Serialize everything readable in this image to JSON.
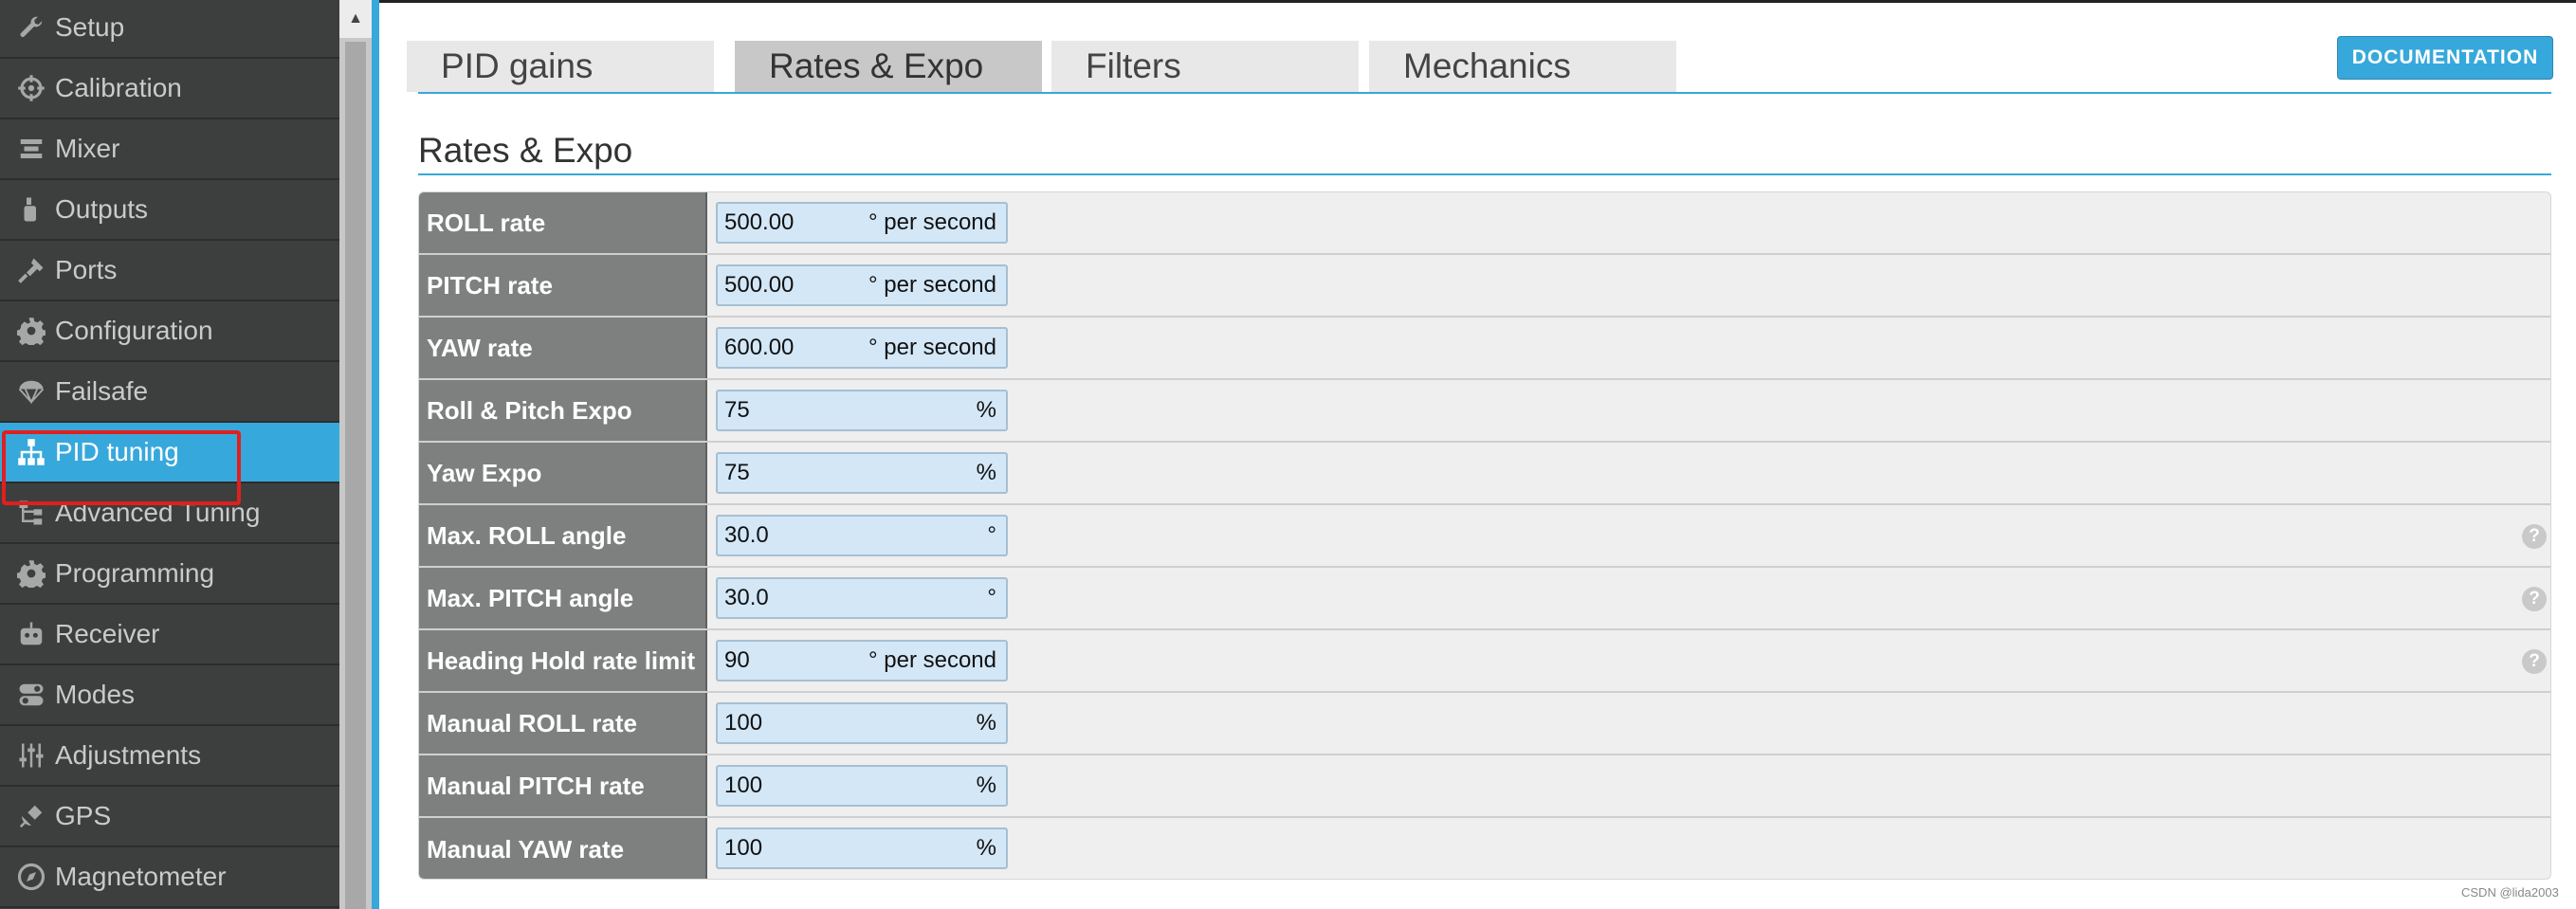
{
  "sidebar": {
    "items": [
      {
        "label": "Setup",
        "icon": "wrench-icon",
        "active": false
      },
      {
        "label": "Calibration",
        "icon": "crosshair-icon",
        "active": false
      },
      {
        "label": "Mixer",
        "icon": "mixer-icon",
        "active": false
      },
      {
        "label": "Outputs",
        "icon": "motor-icon",
        "active": false
      },
      {
        "label": "Ports",
        "icon": "plug-icon",
        "active": false
      },
      {
        "label": "Configuration",
        "icon": "gear-icon",
        "active": false
      },
      {
        "label": "Failsafe",
        "icon": "parachute-icon",
        "active": false
      },
      {
        "label": "PID tuning",
        "icon": "hierarchy-icon",
        "active": true
      },
      {
        "label": "Advanced Tuning",
        "icon": "tree-icon",
        "active": false
      },
      {
        "label": "Programming",
        "icon": "gear-icon",
        "active": false
      },
      {
        "label": "Receiver",
        "icon": "robot-icon",
        "active": false
      },
      {
        "label": "Modes",
        "icon": "toggle-icon",
        "active": false
      },
      {
        "label": "Adjustments",
        "icon": "sliders-icon",
        "active": false
      },
      {
        "label": "GPS",
        "icon": "satellite-icon",
        "active": false
      },
      {
        "label": "Magnetometer",
        "icon": "compass-icon",
        "active": false
      }
    ]
  },
  "tabs": [
    {
      "label": "PID gains",
      "active": false
    },
    {
      "label": "Rates & Expo",
      "active": true
    },
    {
      "label": "Filters",
      "active": false
    },
    {
      "label": "Mechanics",
      "active": false
    }
  ],
  "documentation_button": "DOCUMENTATION",
  "section_title": "Rates & Expo",
  "rows": [
    {
      "label": "ROLL rate",
      "value": "500.00",
      "unit": "° per second",
      "help": false
    },
    {
      "label": "PITCH rate",
      "value": "500.00",
      "unit": "° per second",
      "help": false
    },
    {
      "label": "YAW rate",
      "value": "600.00",
      "unit": "° per second",
      "help": false
    },
    {
      "label": "Roll & Pitch Expo",
      "value": "75",
      "unit": "%",
      "help": false
    },
    {
      "label": "Yaw Expo",
      "value": "75",
      "unit": "%",
      "help": false
    },
    {
      "label": "Max. ROLL angle",
      "value": "30.0",
      "unit": "°",
      "help": true
    },
    {
      "label": "Max. PITCH angle",
      "value": "30.0",
      "unit": "°",
      "help": true
    },
    {
      "label": "Heading Hold rate limit",
      "value": "90",
      "unit": "° per second",
      "help": true
    },
    {
      "label": "Manual ROLL rate",
      "value": "100",
      "unit": "%",
      "help": false
    },
    {
      "label": "Manual PITCH rate",
      "value": "100",
      "unit": "%",
      "help": false
    },
    {
      "label": "Manual YAW rate",
      "value": "100",
      "unit": "%",
      "help": false
    }
  ],
  "help_glyph": "?",
  "scroll_up_glyph": "▲",
  "watermark": "CSDN @lida2003",
  "colors": {
    "accent": "#37a8db",
    "sidebar": "#3d3f3e",
    "highlight": "#e0201f"
  }
}
